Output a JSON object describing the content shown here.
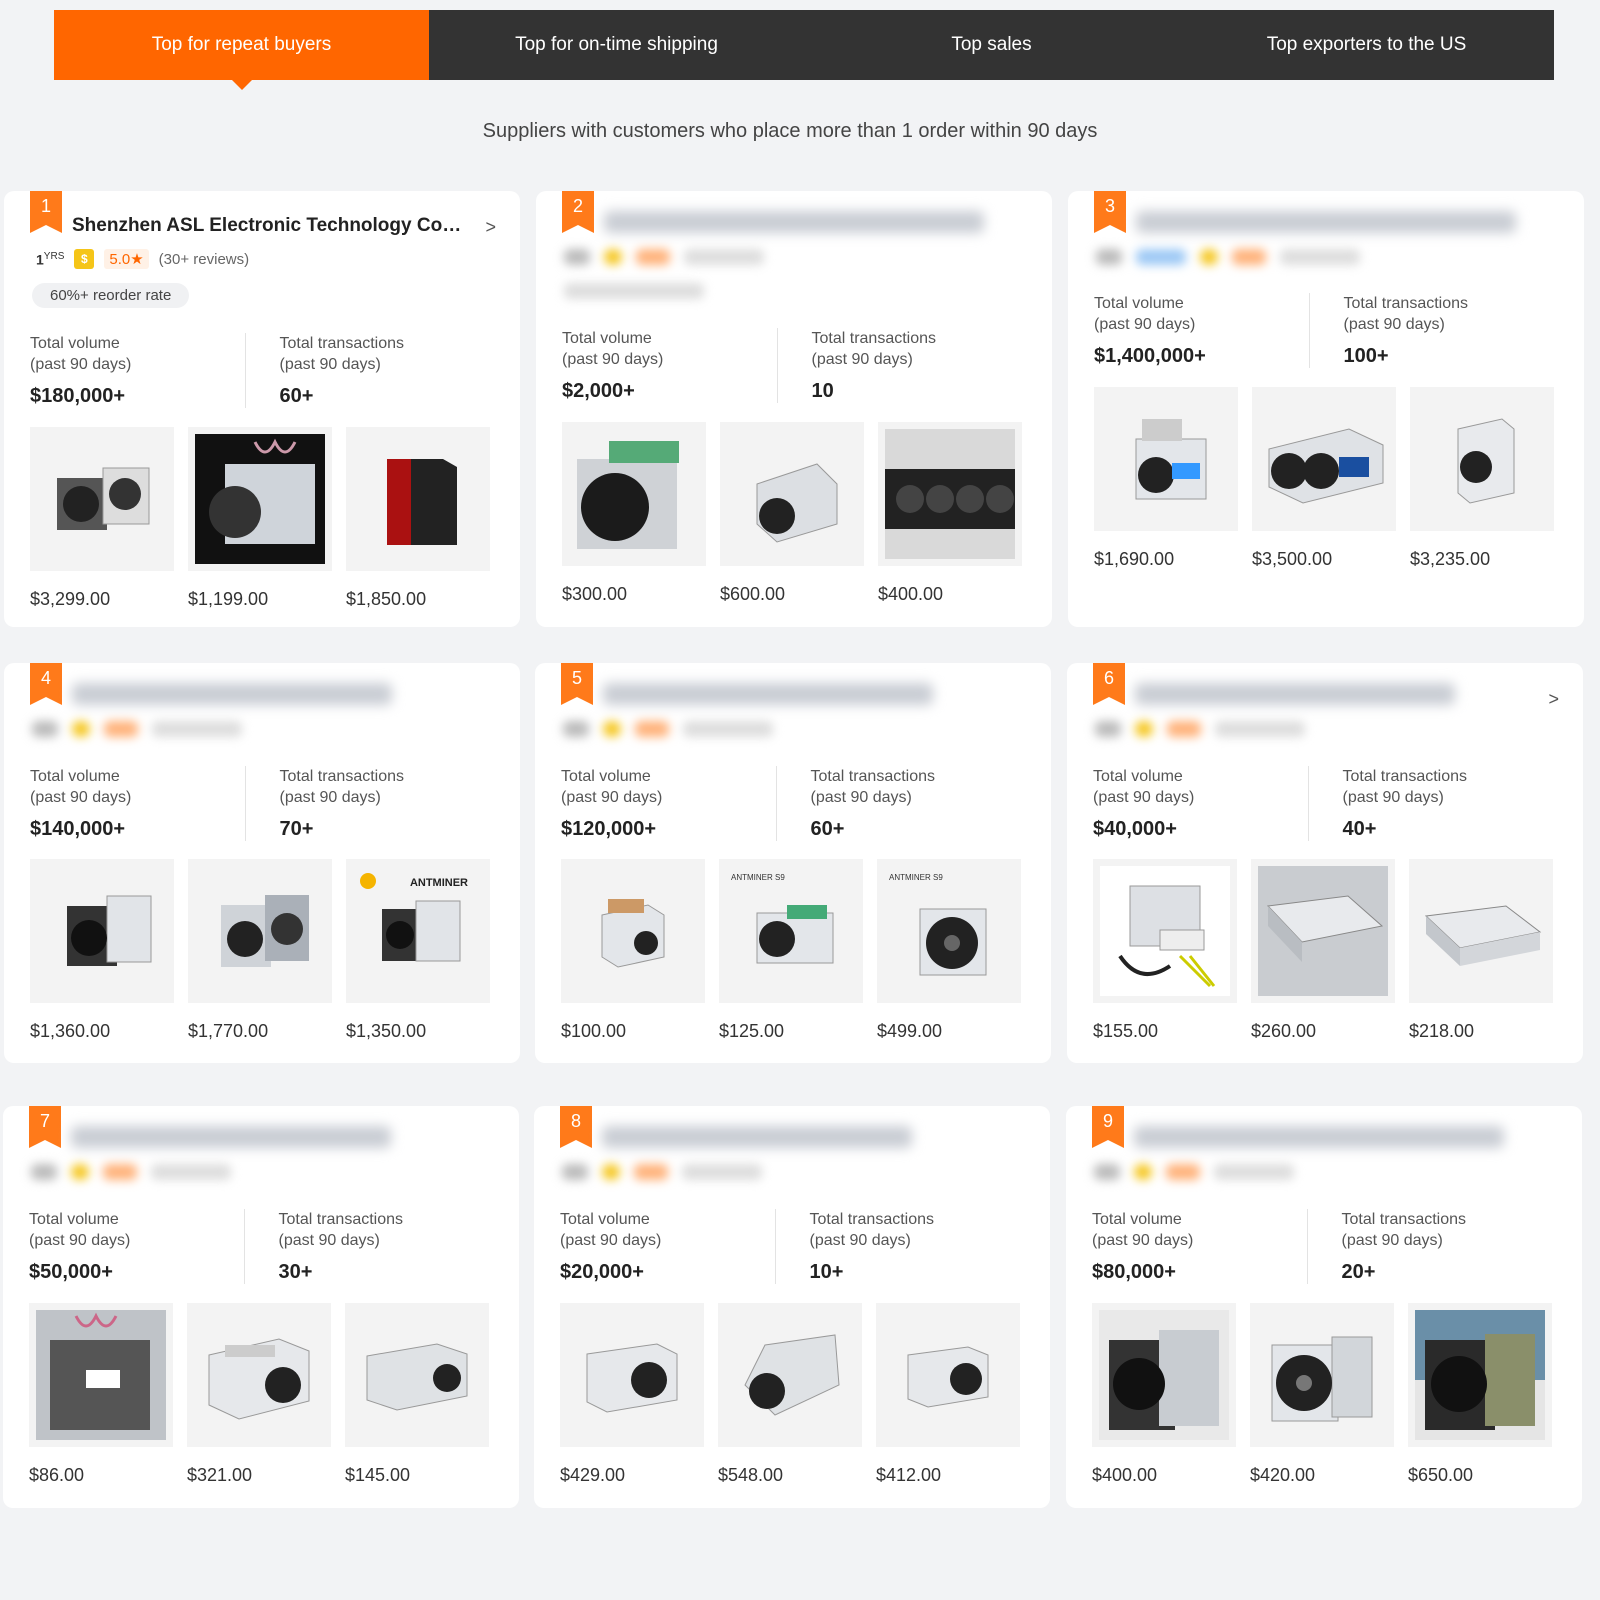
{
  "tabs": [
    {
      "label": "Top for repeat buyers",
      "active": true
    },
    {
      "label": "Top for on-time shipping",
      "active": false
    },
    {
      "label": "Top sales",
      "active": false
    },
    {
      "label": "Top exporters to the US",
      "active": false
    }
  ],
  "subtitle": "Suppliers with customers who place more than 1 order within 90 days",
  "labels": {
    "volume_line1": "Total volume",
    "volume_line2": "(past 90 days)",
    "trans_line1": "Total transactions",
    "trans_line2": "(past 90 days)"
  },
  "colors": {
    "accent": "#ff6600",
    "tabbar": "#333333"
  },
  "cards": [
    {
      "rank": "1",
      "company": "Shenzhen ASL Electronic Technology Co.,...",
      "years": "1",
      "years_unit": "YRS",
      "rating": "5.0★",
      "reviews": "(30+ reviews)",
      "reorder": "60%+ reorder rate",
      "volume": "$180,000+",
      "transactions": "60+",
      "prices": [
        "$3,299.00",
        "$1,199.00",
        "$1,850.00"
      ]
    },
    {
      "rank": "2",
      "volume": "$2,000+",
      "transactions": "10",
      "prices": [
        "$300.00",
        "$600.00",
        "$400.00"
      ]
    },
    {
      "rank": "3",
      "volume": "$1,400,000+",
      "transactions": "100+",
      "prices": [
        "$1,690.00",
        "$3,500.00",
        "$3,235.00"
      ]
    },
    {
      "rank": "4",
      "volume": "$140,000+",
      "transactions": "70+",
      "prices": [
        "$1,360.00",
        "$1,770.00",
        "$1,350.00"
      ]
    },
    {
      "rank": "5",
      "volume": "$120,000+",
      "transactions": "60+",
      "prices": [
        "$100.00",
        "$125.00",
        "$499.00"
      ]
    },
    {
      "rank": "6",
      "volume": "$40,000+",
      "transactions": "40+",
      "prices": [
        "$155.00",
        "$260.00",
        "$218.00"
      ]
    },
    {
      "rank": "7",
      "volume": "$50,000+",
      "transactions": "30+",
      "prices": [
        "$86.00",
        "$321.00",
        "$145.00"
      ]
    },
    {
      "rank": "8",
      "volume": "$20,000+",
      "transactions": "10+",
      "prices": [
        "$429.00",
        "$548.00",
        "$412.00"
      ]
    },
    {
      "rank": "9",
      "volume": "$80,000+",
      "transactions": "20+",
      "prices": [
        "$400.00",
        "$420.00",
        "$650.00"
      ]
    }
  ]
}
